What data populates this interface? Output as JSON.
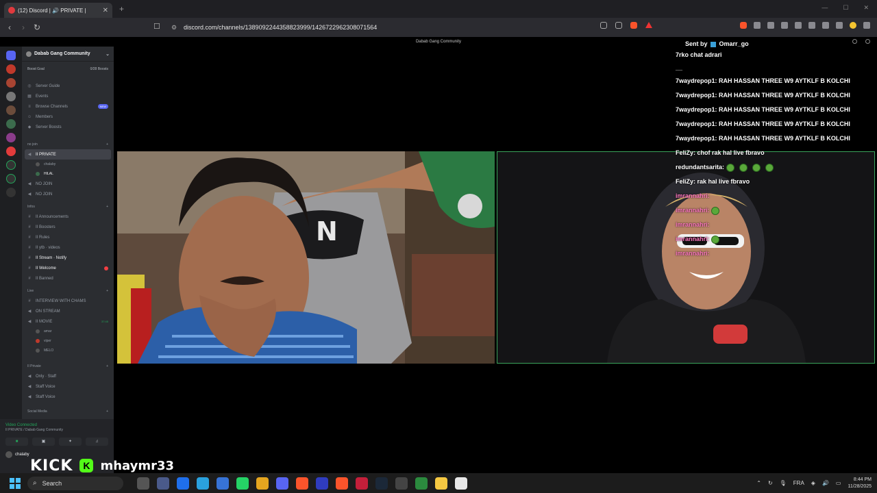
{
  "browser": {
    "tab_title": "(12) Discord | 🔊 PRIVATE |",
    "tab_close": "✕",
    "new_tab": "+",
    "url": "discord.com/channels/1389092244358823999/1426722962308071564",
    "window_controls": [
      "—",
      "☐",
      "✕"
    ]
  },
  "title_strip": {
    "server_name": "Dabab Gang Community"
  },
  "sidebar": {
    "server_name": "Dabab Gang Community",
    "boost_goal": "Boost Goal",
    "boost_count": "0/28 Boosts",
    "top_items": [
      {
        "label": "Server Guide",
        "icon": "compass-icon"
      },
      {
        "label": "Events",
        "icon": "calendar-icon"
      },
      {
        "label": "Browse Channels",
        "icon": "list-icon",
        "badge": "NEW"
      },
      {
        "label": "Members",
        "icon": "members-icon"
      },
      {
        "label": "Server Boosts",
        "icon": "boost-icon"
      }
    ],
    "category_nojoin": "no join",
    "voice_private": "II PRIVATE",
    "voice_private_users": [
      "chalaby",
      "HILAL"
    ],
    "no_join_1": "NO JOIN",
    "no_join_2": "NO JOIN",
    "category_infos": "Infos",
    "text_channels": [
      "II Announcements",
      "II Boosters",
      "II Rules",
      "II ytb · videos",
      "II Stream · Notify",
      "II Welcome",
      "II Banned"
    ],
    "category_live": "Live",
    "live_items": [
      "INTERVIEW WITH CHAMS",
      "ON STREAM",
      "II MOVIE"
    ],
    "movie_time": "37:45",
    "movie_users": [
      "amar",
      "viper",
      "MELO"
    ],
    "category_private": "II Private",
    "private_items": [
      "Only · Staff",
      "Staff Voice",
      "Staff Voice"
    ],
    "category_social": "Social Media"
  },
  "voice_panel": {
    "status": "Video Connected",
    "channel": "II PRIVATE / Dabab Gang Community",
    "username": "chalaby"
  },
  "overlay": {
    "brand": "KICK",
    "streamer": "mhaymr33"
  },
  "chat": {
    "top_partial": "",
    "sent_by": "Sent by",
    "sent_by_user": "Omarr_go",
    "messages": [
      {
        "user": "",
        "text": "7rko chat adrari"
      },
      {
        "user": "",
        "text": "__"
      },
      {
        "user": "7waydrepop1:",
        "text": "RAH HASSAN THREE W9 AYTKLF B KOLCHI"
      },
      {
        "user": "7waydrepop1:",
        "text": "RAH HASSAN THREE W9 AYTKLF B KOLCHI"
      },
      {
        "user": "7waydrepop1:",
        "text": "RAH HASSAN THREE W9 AYTKLF B KOLCHI"
      },
      {
        "user": "7waydrepop1:",
        "text": "RAH HASSAN THREE W9 AYTKLF B KOLCHI"
      },
      {
        "user": "7waydrepop1:",
        "text": "RAH HASSAN THREE W9 AYTKLF B KOLCHI"
      },
      {
        "user": "FeliZy:",
        "text": "chof rak hal live fbravo"
      },
      {
        "user": "redundantsarita:",
        "text": ""
      },
      {
        "user": "FeliZy:",
        "text": "rak hal live fbravo"
      },
      {
        "user": "imrannahri:",
        "text": ""
      },
      {
        "user": "imrannahri:",
        "text": ""
      },
      {
        "user": "imrannahri:",
        "text": ""
      },
      {
        "user": "imrannahri:",
        "text": ""
      },
      {
        "user": "imrannahri:",
        "text": ""
      }
    ]
  },
  "taskbar": {
    "search_placeholder": "Search",
    "language": "FRA",
    "time": "8:44 PM",
    "date": "11/28/2025"
  }
}
